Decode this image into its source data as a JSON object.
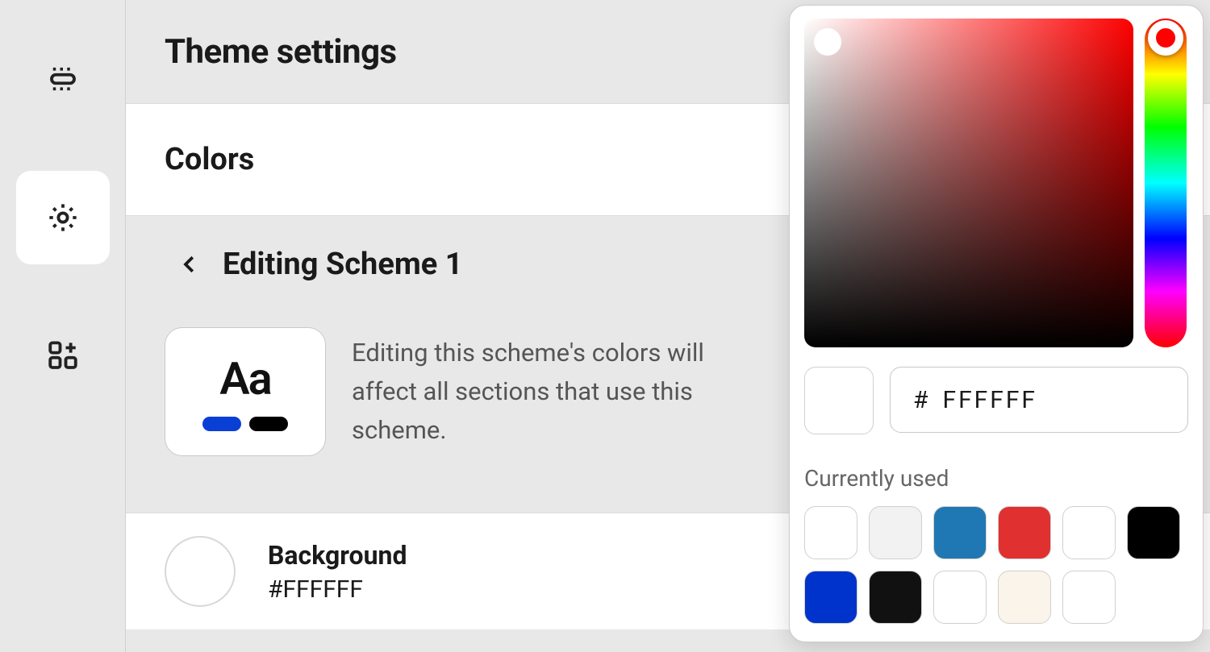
{
  "header": {
    "title": "Theme settings"
  },
  "section": {
    "title": "Colors"
  },
  "breadcrumb": {
    "title": "Editing Scheme 1"
  },
  "scheme_card": {
    "sample_text": "Aa",
    "description": "Editing this scheme's colors will affect all sections that use this scheme.",
    "pill_colors": [
      "#0a3fd6",
      "#000000"
    ]
  },
  "background_item": {
    "label": "Background",
    "value": "#FFFFFF",
    "swatch_color": "#FFFFFF"
  },
  "picker": {
    "hash": "#",
    "hex_value": "FFFFFF",
    "current_swatch": "#FFFFFF",
    "hue_color": "#ff0000",
    "used_label": "Currently used",
    "used_colors": [
      "#FFFFFF",
      "#F2F2F2",
      "#1F78B4",
      "#E13030",
      "#FFFFFF",
      "#000000",
      "#0033CC",
      "#111111",
      "#FFFFFF",
      "#FAF4EA",
      "#FFFFFF"
    ]
  }
}
